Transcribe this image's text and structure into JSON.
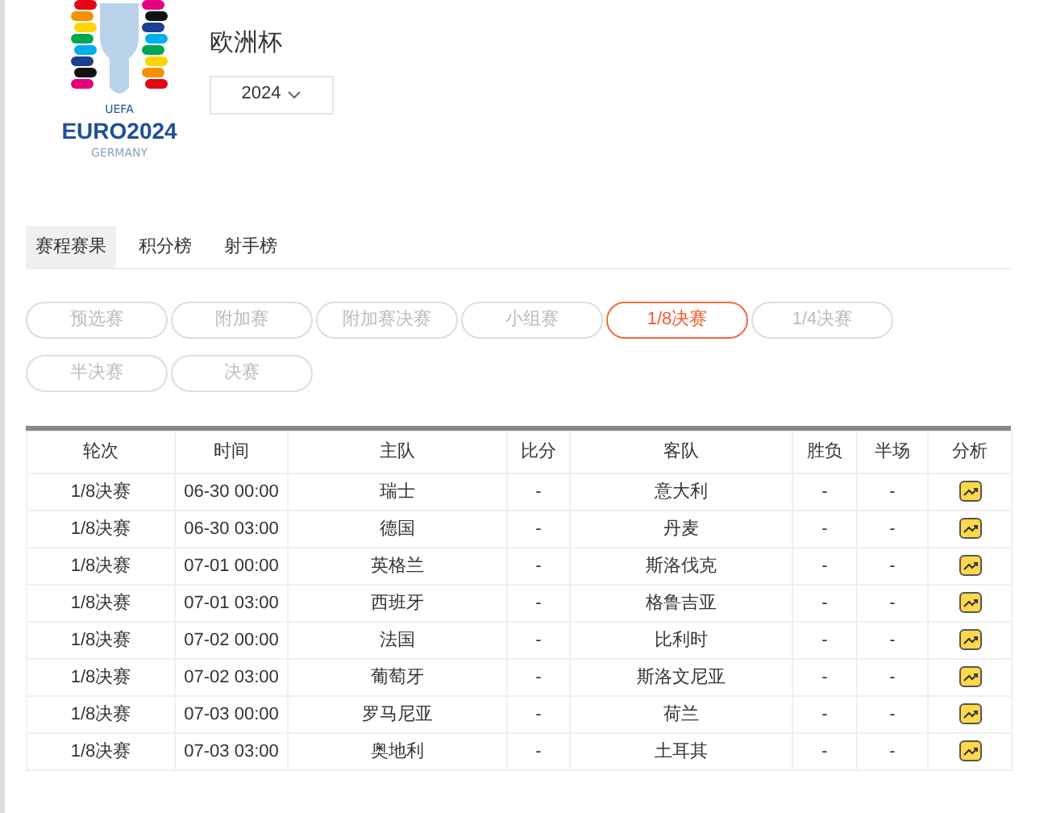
{
  "logo": {
    "org": "UEFA",
    "name": "EURO2024",
    "host": "GERMANY"
  },
  "title": "欧洲杯",
  "season_select": {
    "value": "2024"
  },
  "tabs": [
    {
      "label": "赛程赛果",
      "selected": true
    },
    {
      "label": "积分榜",
      "selected": false
    },
    {
      "label": "射手榜",
      "selected": false
    }
  ],
  "stages": [
    {
      "label": "预选赛",
      "selected": false
    },
    {
      "label": "附加赛",
      "selected": false
    },
    {
      "label": "附加赛决赛",
      "selected": false
    },
    {
      "label": "小组赛",
      "selected": false
    },
    {
      "label": "1/8决赛",
      "selected": true
    },
    {
      "label": "1/4决赛",
      "selected": false
    },
    {
      "label": "半决赛",
      "selected": false
    },
    {
      "label": "决赛",
      "selected": false
    }
  ],
  "table": {
    "columns": [
      "轮次",
      "时间",
      "主队",
      "比分",
      "客队",
      "胜负",
      "半场",
      "分析"
    ],
    "rows": [
      {
        "round": "1/8决赛",
        "time": "06-30 00:00",
        "home": "瑞士",
        "score": "-",
        "away": "意大利",
        "result": "-",
        "half": "-"
      },
      {
        "round": "1/8决赛",
        "time": "06-30 03:00",
        "home": "德国",
        "score": "-",
        "away": "丹麦",
        "result": "-",
        "half": "-"
      },
      {
        "round": "1/8决赛",
        "time": "07-01 00:00",
        "home": "英格兰",
        "score": "-",
        "away": "斯洛伐克",
        "result": "-",
        "half": "-"
      },
      {
        "round": "1/8决赛",
        "time": "07-01 03:00",
        "home": "西班牙",
        "score": "-",
        "away": "格鲁吉亚",
        "result": "-",
        "half": "-"
      },
      {
        "round": "1/8决赛",
        "time": "07-02 00:00",
        "home": "法国",
        "score": "-",
        "away": "比利时",
        "result": "-",
        "half": "-"
      },
      {
        "round": "1/8决赛",
        "time": "07-02 03:00",
        "home": "葡萄牙",
        "score": "-",
        "away": "斯洛文尼亚",
        "result": "-",
        "half": "-"
      },
      {
        "round": "1/8决赛",
        "time": "07-03 00:00",
        "home": "罗马尼亚",
        "score": "-",
        "away": "荷兰",
        "result": "-",
        "half": "-"
      },
      {
        "round": "1/8决赛",
        "time": "07-03 03:00",
        "home": "奥地利",
        "score": "-",
        "away": "土耳其",
        "result": "-",
        "half": "-"
      }
    ]
  }
}
